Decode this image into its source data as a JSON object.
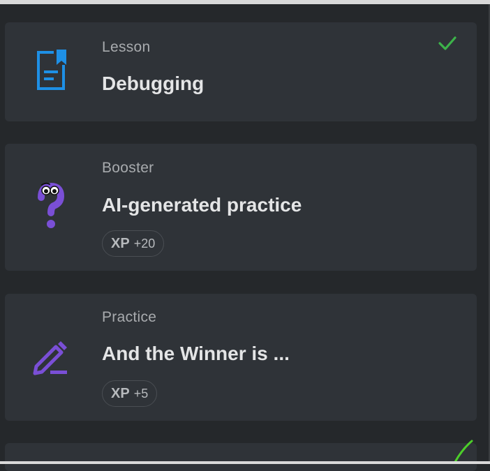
{
  "items": [
    {
      "type": "Lesson",
      "title": "Debugging",
      "icon": "lesson-document-icon",
      "completed": true
    },
    {
      "type": "Booster",
      "title": "AI-generated practice",
      "icon": "booster-question-icon",
      "xp_label": "XP",
      "xp_value": "+20"
    },
    {
      "type": "Practice",
      "title": "And the Winner is ...",
      "icon": "practice-pencil-icon",
      "xp_label": "XP",
      "xp_value": "+5"
    }
  ],
  "colors": {
    "background": "#25282b",
    "card": "#2f3338",
    "lesson_icon": "#1e90e6",
    "booster_icon": "#7a4fd6",
    "practice_icon": "#7a4fd6",
    "check": "#3db34a"
  }
}
